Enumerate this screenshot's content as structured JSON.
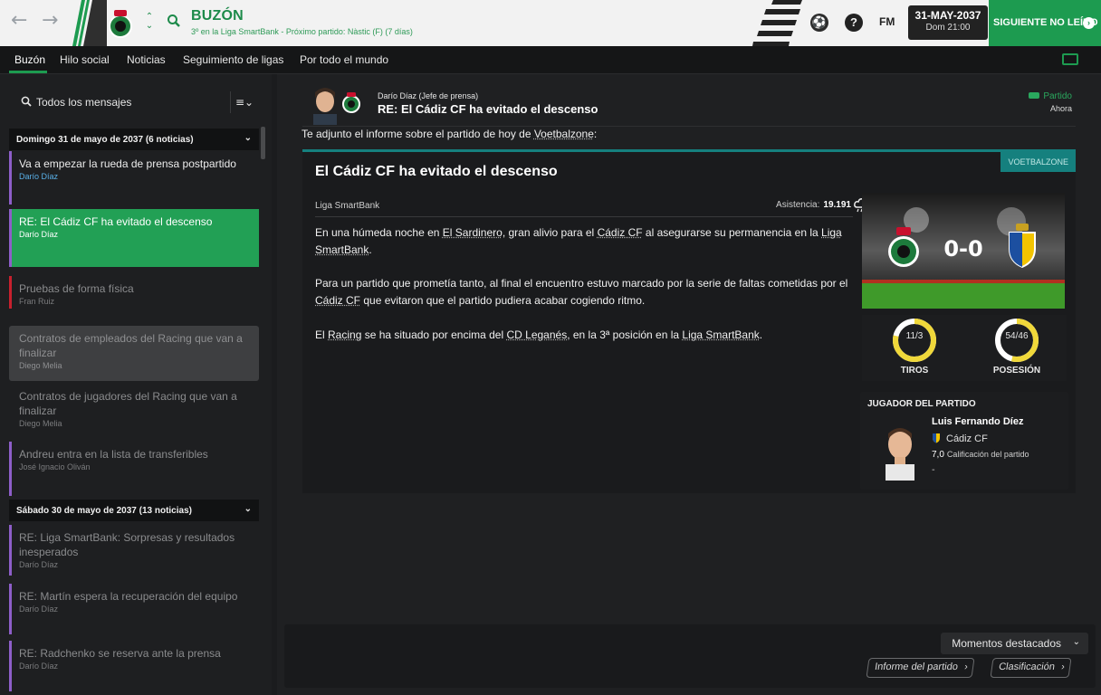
{
  "header": {
    "title": "BUZÓN",
    "subtitle": "3º en la Liga SmartBank - Próximo partido: Nàstic (F) (7 días)",
    "fm_logo": "FM",
    "date": "31-MAY-2037",
    "date_sub": "Dom 21:00",
    "next_unread": "SIGUIENTE NO LEÍDO",
    "icons": {
      "back": "back-arrow-icon",
      "forward": "forward-arrow-icon",
      "search": "search-icon",
      "ball": "football-icon",
      "help": "help-icon"
    }
  },
  "tabs": [
    "Buzón",
    "Hilo social",
    "Noticias",
    "Seguimiento de ligas",
    "Por todo el mundo"
  ],
  "inbox": {
    "filter_label": "Todos los mensajes",
    "groups": [
      {
        "header": "Domingo 31 de mayo de 2037 (6 noticias)",
        "messages": [
          {
            "title": "Va a empezar la rueda de prensa postpartido",
            "sender": "Darío Díaz"
          },
          {
            "title": "RE: El Cádiz CF ha evitado el descenso",
            "sender": "Darío Díaz"
          },
          {
            "title": "Pruebas de forma física",
            "sender": "Fran Ruiz"
          },
          {
            "title": "Contratos de empleados del Racing que van a finalizar",
            "sender": "Diego Melia"
          },
          {
            "title": "Contratos de jugadores del Racing que van a finalizar",
            "sender": "Diego Melia"
          },
          {
            "title": "Andreu entra en la lista de transferibles",
            "sender": "José Ignacio Oliván"
          }
        ]
      },
      {
        "header": "Sábado 30 de mayo de 2037 (13 noticias)",
        "messages": [
          {
            "title": "RE: Liga SmartBank: Sorpresas y resultados inesperados",
            "sender": "Darío Díaz"
          },
          {
            "title": "RE: Martín espera la recuperación del equipo",
            "sender": "Darío Díaz"
          },
          {
            "title": "RE: Radchenko se reserva ante la prensa",
            "sender": "Darío Díaz"
          }
        ]
      }
    ]
  },
  "message": {
    "sender_name": "Darío Díaz",
    "sender_role": "(Jefe de prensa)",
    "subject": "RE: El Cádiz CF ha evitado el descenso",
    "type": "Partido",
    "time": "Ahora",
    "intro_prefix": "Te adjunto el informe sobre el partido de hoy de ",
    "intro_source": "Voetbalzone",
    "intro_suffix": ":"
  },
  "article": {
    "source": "VOETBALZONE",
    "title": "El Cádiz CF ha evitado el descenso",
    "league": "Liga SmartBank",
    "attendance_label": "Asistencia:",
    "attendance_value": "19.191",
    "p1": {
      "a": "En una húmeda noche en ",
      "stadium": "El Sardinero",
      "b": ", gran alivio para el ",
      "club": "Cádiz CF",
      "c": " al asegurarse su permanencia en la ",
      "league": "Liga SmartBank",
      "d": "."
    },
    "p2": {
      "a": "Para un partido que prometía tanto, al final el encuentro estuvo marcado por la serie de faltas cometidas por el ",
      "club": "Cádiz CF",
      "b": " que evitaron que el partido pudiera acabar cogiendo ritmo."
    },
    "p3": {
      "a": "El ",
      "club1": "Racing",
      "b": " se ha situado por encima del ",
      "club2": "CD Leganés",
      "c": ", en la 3ª posición en la ",
      "league": "Liga SmartBank",
      "d": "."
    }
  },
  "match": {
    "score": "0-0",
    "shots": "11/3",
    "shots_label": "TIROS",
    "shots_share": 0.786,
    "possession": "54/46",
    "possession_label": "POSESIÓN",
    "possession_share": 0.54
  },
  "potm": {
    "title": "JUGADOR DEL PARTIDO",
    "name": "Luis Fernando Díez",
    "club": "Cádiz CF",
    "rating": "7,0",
    "rating_label": "Calificación del partido",
    "extra": "-"
  },
  "actions": {
    "highlights": "Momentos destacados",
    "match_report": "Informe del partido",
    "table": "Clasificación"
  },
  "colors": {
    "accent": "#1d9b50",
    "selected": "#22a055",
    "source": "#15807e",
    "sender_link": "#59b0e8",
    "gauge": "#f0d83a"
  }
}
